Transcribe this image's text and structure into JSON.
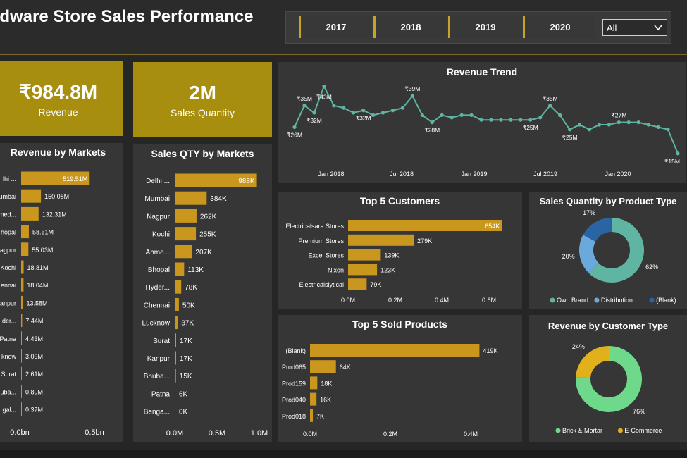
{
  "header": {
    "title": "rdware Store Sales Performance",
    "years": [
      "2017",
      "2018",
      "2019",
      "2020"
    ],
    "filter_value": "All"
  },
  "kpis": [
    {
      "value": "₹984.8M",
      "label": "Revenue"
    },
    {
      "value": "2M",
      "label": "Sales Quantity"
    }
  ],
  "colors": {
    "bar": "#c9961e",
    "accent": "#c9a227",
    "line": "#5fb5a2",
    "kpi_bg": "#a88e0e"
  },
  "chart_data": [
    {
      "id": "revenue_by_markets",
      "type": "bar",
      "orientation": "horizontal",
      "title": "Revenue by Markets",
      "categories": [
        "lhi ...",
        "umbai",
        "med...",
        "hopal",
        "agpur",
        "Kochi",
        "ennai",
        "anpur",
        "der...",
        "Patna",
        "know",
        "Surat",
        "uba...",
        "gal..."
      ],
      "values": [
        519.51,
        150.08,
        132.31,
        58.61,
        55.03,
        18.81,
        18.04,
        13.58,
        7.44,
        4.43,
        3.09,
        2.61,
        0.89,
        0.37
      ],
      "value_labels": [
        "519.51M",
        "150.08M",
        "132.31M",
        "58.61M",
        "55.03M",
        "18.81M",
        "18.04M",
        "13.58M",
        "7.44M",
        "4.43M",
        "3.09M",
        "2.61M",
        "0.89M",
        "0.37M"
      ],
      "x_ticks": [
        "0.0bn",
        "0.5bn"
      ],
      "unit": "M",
      "xlim": [
        0,
        545
      ]
    },
    {
      "id": "sales_qty_by_markets",
      "type": "bar",
      "orientation": "horizontal",
      "title": "Sales QTY by Markets",
      "categories": [
        "Delhi ...",
        "Mumbai",
        "Nagpur",
        "Kochi",
        "Ahme...",
        "Bhopal",
        "Hyder...",
        "Chennai",
        "Lucknow",
        "Surat",
        "Kanpur",
        "Bhuba...",
        "Patna",
        "Benga..."
      ],
      "values": [
        988,
        384,
        262,
        255,
        207,
        113,
        78,
        50,
        37,
        17,
        17,
        15,
        6,
        0
      ],
      "value_labels": [
        "988K",
        "384K",
        "262K",
        "255K",
        "207K",
        "113K",
        "78K",
        "50K",
        "37K",
        "17K",
        "17K",
        "15K",
        "6K",
        "0K"
      ],
      "x_ticks": [
        "0.0M",
        "0.5M",
        "1.0M"
      ],
      "unit": "K",
      "xlim": [
        0,
        1000
      ]
    },
    {
      "id": "revenue_trend",
      "type": "line",
      "title": "Revenue Trend",
      "x_ticks": [
        "Jan 2018",
        "Jul 2018",
        "Jan 2019",
        "Jul 2019",
        "Jan 2020"
      ],
      "ylim": [
        12,
        42
      ],
      "series": [
        {
          "values": [
            26,
            35,
            32,
            43,
            35,
            34,
            32,
            33,
            31,
            32,
            33,
            34,
            39,
            31,
            28,
            31,
            30,
            31,
            31,
            29,
            29,
            29,
            29,
            29,
            29,
            30,
            35,
            31,
            25,
            27,
            25,
            27,
            27,
            28,
            28,
            28,
            27,
            26,
            25,
            15
          ]
        }
      ],
      "data_labels": [
        {
          "i": 0,
          "text": "₹26M"
        },
        {
          "i": 1,
          "text": "₹35M"
        },
        {
          "i": 2,
          "text": "₹32M"
        },
        {
          "i": 3,
          "text": "₹43M"
        },
        {
          "i": 7,
          "text": "₹32M"
        },
        {
          "i": 12,
          "text": "₹39M"
        },
        {
          "i": 14,
          "text": "₹28M"
        },
        {
          "i": 24,
          "text": "₹25M"
        },
        {
          "i": 26,
          "text": "₹35M"
        },
        {
          "i": 28,
          "text": "₹25M"
        },
        {
          "i": 33,
          "text": "₹27M"
        },
        {
          "i": 39,
          "text": "₹15M"
        }
      ]
    },
    {
      "id": "top5_customers",
      "type": "bar",
      "orientation": "horizontal",
      "title": "Top 5 Customers",
      "categories": [
        "Electricalsara Stores",
        "Premium Stores",
        "Excel Stores",
        "Nixon",
        "Electricalslytical"
      ],
      "values": [
        654,
        279,
        139,
        123,
        79
      ],
      "value_labels": [
        "654K",
        "279K",
        "139K",
        "123K",
        "79K"
      ],
      "x_ticks": [
        "0.0M",
        "0.2M",
        "0.4M",
        "0.6M"
      ],
      "unit": "K",
      "xlim": [
        0,
        650
      ]
    },
    {
      "id": "top5_products",
      "type": "bar",
      "orientation": "horizontal",
      "title": "Top 5 Sold Products",
      "categories": [
        "(Blank)",
        "Prod065",
        "Prod159",
        "Prod040",
        "Prod018"
      ],
      "values": [
        419,
        64,
        18,
        16,
        7
      ],
      "value_labels": [
        "419K",
        "64K",
        "18K",
        "16K",
        "7K"
      ],
      "x_ticks": [
        "0.0M",
        "0.2M",
        "0.4M"
      ],
      "unit": "K",
      "xlim": [
        0,
        420
      ]
    },
    {
      "id": "qty_by_product_type",
      "type": "pie",
      "donut": true,
      "title": "Sales Quantity by Product Type",
      "labels": [
        "Own Brand",
        "Distribution",
        "(Blank)"
      ],
      "values": [
        62,
        20,
        17
      ],
      "value_labels": [
        "62%",
        "20%",
        "17%"
      ],
      "colors": [
        "#5fb5a2",
        "#6aa9dc",
        "#2a64a3"
      ],
      "legend": "bottom"
    },
    {
      "id": "revenue_by_customer_type",
      "type": "pie",
      "donut": true,
      "title": "Revenue by Customer Type",
      "labels": [
        "Brick & Mortar",
        "E-Commerce"
      ],
      "values": [
        76,
        24
      ],
      "value_labels": [
        "76%",
        "24%"
      ],
      "colors": [
        "#6ed98a",
        "#e0b11a"
      ],
      "legend": "bottom"
    }
  ]
}
